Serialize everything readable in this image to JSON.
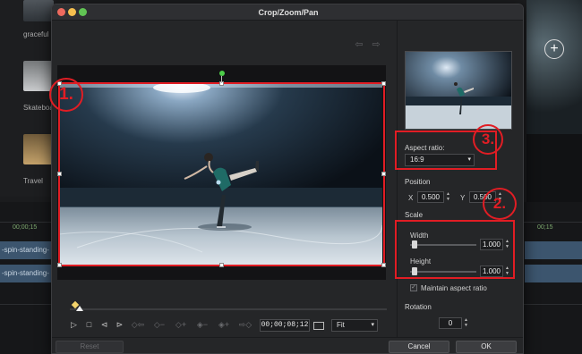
{
  "background": {
    "thumbnails": [
      "graceful",
      "Skateboa",
      "Travel"
    ],
    "timeline_time_left": "00;00;15",
    "timeline_time_right": "00;15",
    "clip_label": "-spin-standing-",
    "clip_label_2": "-spin-standing-"
  },
  "dialog": {
    "title": "Crop/Zoom/Pan",
    "nav_back": "⇦",
    "nav_forward": "⇨"
  },
  "player": {
    "timecode": "00;00;08;12",
    "fit_value": "Fit",
    "progress": 0.02
  },
  "panel": {
    "aspect_ratio_label": "Aspect ratio:",
    "aspect_ratio_value": "16:9",
    "position_label": "Position",
    "x_label": "X",
    "x_value": "0.500",
    "y_label": "Y",
    "y_value": "0.500",
    "scale_label": "Scale",
    "width_label": "Width",
    "width_value": "1.000",
    "height_label": "Height",
    "height_value": "1.000",
    "maintain_label": "Maintain aspect ratio",
    "maintain_checked": true,
    "rotation_label": "Rotation",
    "rotation_value": "0"
  },
  "footer": {
    "reset_label": "Reset",
    "cancel_label": "Cancel",
    "ok_label": "OK"
  },
  "annotations": {
    "one": "1.",
    "two": "2.",
    "three": "3."
  },
  "colors": {
    "annotation_red": "#e11d24",
    "rotate_handle_green": "#4ccc48"
  }
}
